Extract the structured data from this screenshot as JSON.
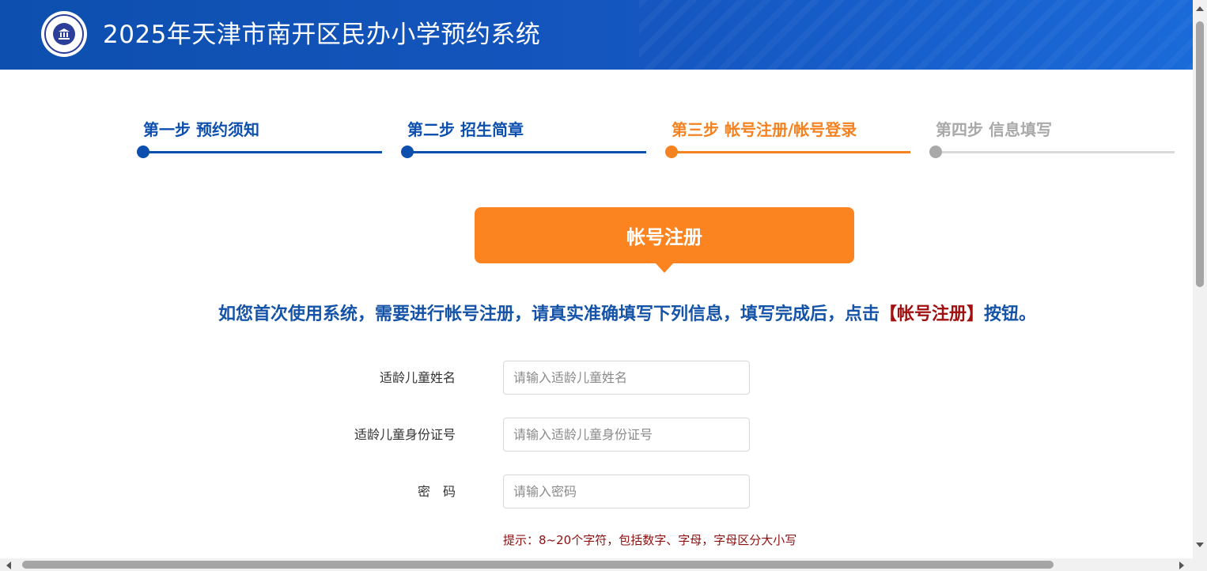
{
  "header": {
    "title": "2025年天津市南开区民办小学预约系统",
    "logo_icon": "school-emblem-icon"
  },
  "steps": [
    {
      "label": "第一步 预约须知",
      "state": "done"
    },
    {
      "label": "第二步 招生简章",
      "state": "done"
    },
    {
      "label": "第三步 帐号注册/帐号登录",
      "state": "active"
    },
    {
      "label": "第四步 信息填写",
      "state": "todo"
    }
  ],
  "banner": {
    "title": "帐号注册"
  },
  "instruction": {
    "text": "如您首次使用系统，需要进行帐号注册，请真实准确填写下列信息，填写完成后，点击",
    "highlight": "【帐号注册】",
    "suffix": "按钮。"
  },
  "form": {
    "child_name": {
      "label": "适龄儿童姓名",
      "placeholder": "请输入适龄儿童姓名",
      "value": ""
    },
    "child_id": {
      "label": "适龄儿童身份证号",
      "placeholder": "请输入适龄儿童身份证号",
      "value": ""
    },
    "password": {
      "label": "密　码",
      "placeholder": "请输入密码",
      "value": ""
    },
    "password_hint": "提示：8~20个字符，包括数字、字母，字母区分大小写"
  },
  "colors": {
    "primary": "#0d4fae",
    "accent": "#f58220",
    "banner": "#fb8421",
    "highlight": "#a21111",
    "inactive": "#a9a9a9"
  }
}
